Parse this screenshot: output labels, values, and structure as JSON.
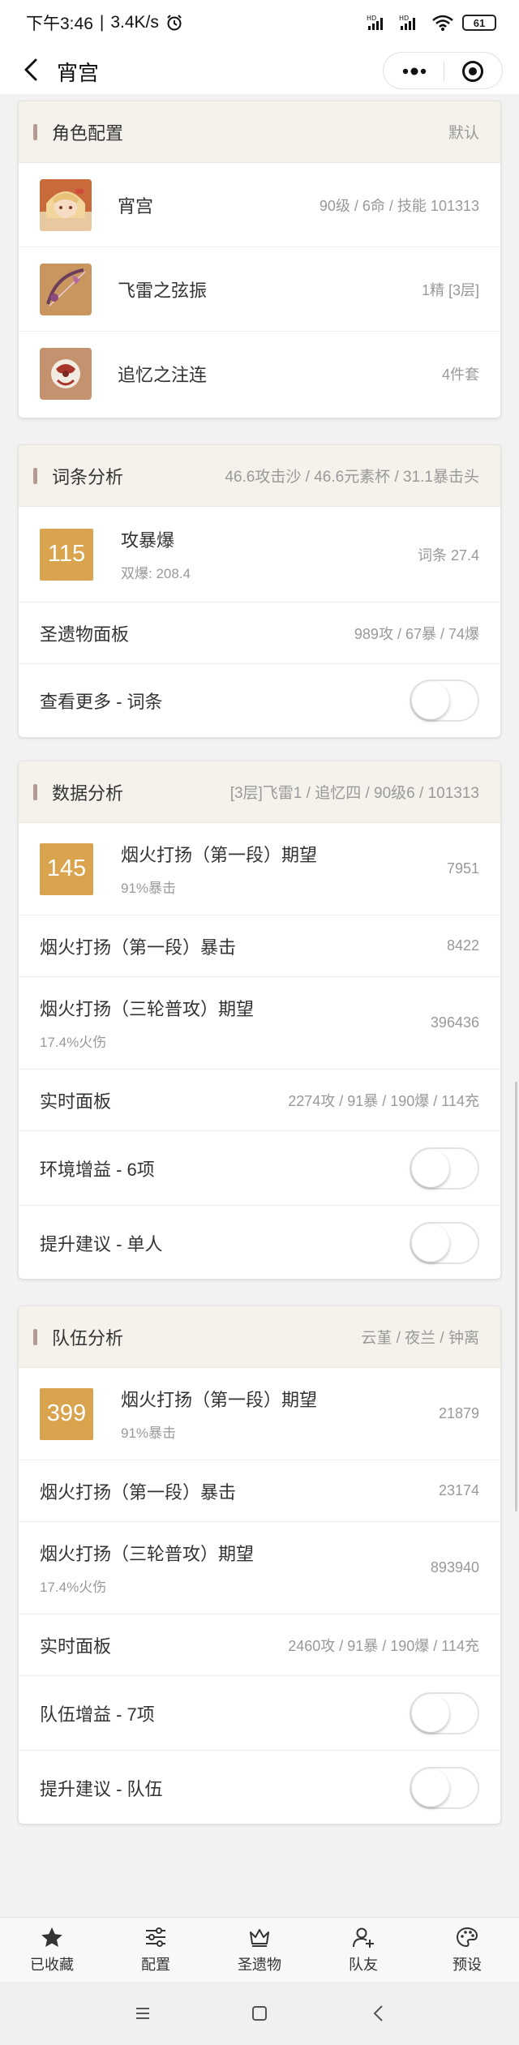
{
  "status": {
    "time": "下午3:46",
    "speed": "3.4K/s",
    "battery": "61"
  },
  "header": {
    "title": "宵宫"
  },
  "card_role": {
    "title": "角色配置",
    "sub": "默认",
    "items": [
      {
        "name": "宵宫",
        "value": "90级 / 6命 / 技能 101313"
      },
      {
        "name": "飞雷之弦振",
        "value": "1精 [3层]"
      },
      {
        "name": "追忆之注连",
        "value": "4件套"
      }
    ]
  },
  "card_stats": {
    "title": "词条分析",
    "sub": "46.6攻击沙 / 46.6元素杯 / 31.1暴击头",
    "score": "115",
    "score_label": "攻暴爆",
    "score_sub": "双爆: 208.4",
    "score_value": "词条 27.4",
    "panel_label": "圣遗物面板",
    "panel_value": "989攻 / 67暴 / 74爆",
    "more_label": "查看更多 - 词条"
  },
  "card_data": {
    "title": "数据分析",
    "sub": "[3层]飞雷1 / 追忆四 / 90级6 / 101313",
    "score": "145",
    "rows": [
      {
        "label": "烟火打扬（第一段）期望",
        "sub": "91%暴击",
        "value": "7951"
      },
      {
        "label": "烟火打扬（第一段）暴击",
        "value": "8422"
      },
      {
        "label": "烟火打扬（三轮普攻）期望",
        "sub": "17.4%火伤",
        "value": "396436"
      },
      {
        "label": "实时面板",
        "value": "2274攻 / 91暴 / 190爆 / 114充"
      }
    ],
    "toggle1": "环境增益 - 6项",
    "toggle2": "提升建议 - 单人"
  },
  "card_team": {
    "title": "队伍分析",
    "sub": "云堇 / 夜兰 / 钟离",
    "score": "399",
    "rows": [
      {
        "label": "烟火打扬（第一段）期望",
        "sub": "91%暴击",
        "value": "21879"
      },
      {
        "label": "烟火打扬（第一段）暴击",
        "value": "23174"
      },
      {
        "label": "烟火打扬（三轮普攻）期望",
        "sub": "17.4%火伤",
        "value": "893940"
      },
      {
        "label": "实时面板",
        "value": "2460攻 / 91暴 / 190爆 / 114充"
      }
    ],
    "toggle1": "队伍增益 - 7项",
    "toggle2": "提升建议 - 队伍"
  },
  "tabs": [
    {
      "label": "已收藏",
      "icon": "star-icon"
    },
    {
      "label": "配置",
      "icon": "sliders-icon"
    },
    {
      "label": "圣遗物",
      "icon": "crown-icon"
    },
    {
      "label": "队友",
      "icon": "add-user-icon"
    },
    {
      "label": "预设",
      "icon": "palette-icon"
    }
  ]
}
